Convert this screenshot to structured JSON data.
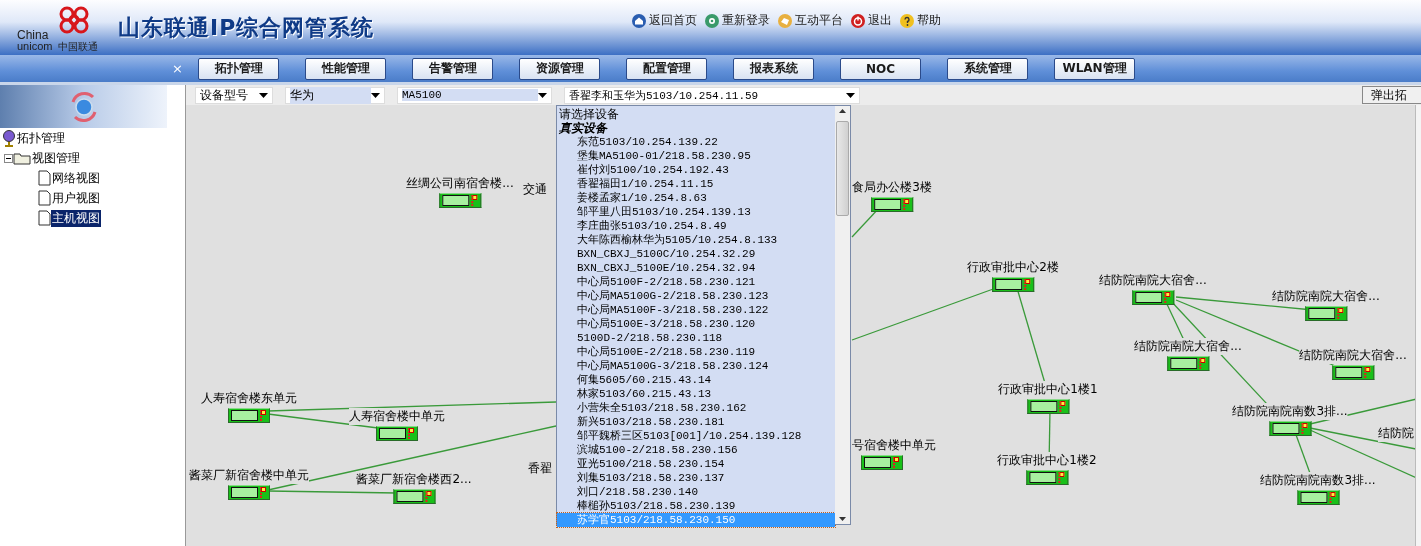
{
  "header": {
    "logo": {
      "line1": "China",
      "line2": "unicom",
      "line3": "中国联通"
    },
    "title": "山东联通IP综合网管系统",
    "links": [
      {
        "label": "返回首页"
      },
      {
        "label": "重新登录"
      },
      {
        "label": "互动平台"
      },
      {
        "label": "退出"
      },
      {
        "label": "帮助"
      }
    ]
  },
  "nav": {
    "close": "×",
    "tabs": [
      {
        "label": "拓扑管理",
        "selected": false
      },
      {
        "label": "性能管理",
        "selected": false
      },
      {
        "label": "告警管理",
        "selected": false
      },
      {
        "label": "资源管理",
        "selected": false
      },
      {
        "label": "配置管理",
        "selected": false
      },
      {
        "label": "报表系统",
        "selected": false
      },
      {
        "label": "NOC",
        "selected": false
      },
      {
        "label": "系统管理",
        "selected": false
      },
      {
        "label": "WLAN管理",
        "selected": false
      }
    ]
  },
  "sidebar": {
    "tree": [
      {
        "label": "拓扑管理",
        "selected": false,
        "children": [
          {
            "label": "视图管理",
            "selected": false,
            "expanded": true,
            "children": [
              {
                "label": "网络视图",
                "selected": false
              },
              {
                "label": "用户视图",
                "selected": false
              },
              {
                "label": "主机视图",
                "selected": true
              }
            ]
          }
        ]
      }
    ]
  },
  "filters": {
    "type": "设备型号",
    "vendor": "华为",
    "model": "MA5100",
    "device": "香翟李和玉华为5103/10.254.11.59",
    "popup_button": "弹出拓"
  },
  "device_list": [
    {
      "kind": "prompt",
      "label": "请选择设备",
      "selected": false
    },
    {
      "kind": "group",
      "label": "真实设备",
      "selected": false
    },
    {
      "kind": "item",
      "label": "东范5103/10.254.139.22",
      "selected": false
    },
    {
      "kind": "item",
      "label": "堡集MA5100-01/218.58.230.95",
      "selected": false
    },
    {
      "kind": "item",
      "label": "崔付刘5100/10.254.192.43",
      "selected": false
    },
    {
      "kind": "item",
      "label": "香翟福田1/10.254.11.15",
      "selected": false
    },
    {
      "kind": "item",
      "label": "姜楼孟家1/10.254.8.63",
      "selected": false
    },
    {
      "kind": "item",
      "label": "邹平里八田5103/10.254.139.13",
      "selected": false
    },
    {
      "kind": "item",
      "label": "李庄曲张5103/10.254.8.49",
      "selected": false
    },
    {
      "kind": "item",
      "label": "大年陈西榆林华为5105/10.254.8.133",
      "selected": false
    },
    {
      "kind": "item",
      "label": "BXN_CBXJ_5100C/10.254.32.29",
      "selected": false
    },
    {
      "kind": "item",
      "label": "BXN_CBXJ_5100E/10.254.32.94",
      "selected": false
    },
    {
      "kind": "item",
      "label": "中心局5100F-2/218.58.230.121",
      "selected": false
    },
    {
      "kind": "item",
      "label": "中心局MA5100G-2/218.58.230.123",
      "selected": false
    },
    {
      "kind": "item",
      "label": "中心局MA5100F-3/218.58.230.122",
      "selected": false
    },
    {
      "kind": "item",
      "label": "中心局5100E-3/218.58.230.120",
      "selected": false
    },
    {
      "kind": "item",
      "label": "5100D-2/218.58.230.118",
      "selected": false
    },
    {
      "kind": "item",
      "label": "中心局5100E-2/218.58.230.119",
      "selected": false
    },
    {
      "kind": "item",
      "label": "中心局MA5100G-3/218.58.230.124",
      "selected": false
    },
    {
      "kind": "item",
      "label": "何集5605/60.215.43.14",
      "selected": false
    },
    {
      "kind": "item",
      "label": "林家5103/60.215.43.13",
      "selected": false
    },
    {
      "kind": "item",
      "label": "小营朱全5103/218.58.230.162",
      "selected": false
    },
    {
      "kind": "item",
      "label": "新兴5103/218.58.230.181",
      "selected": false
    },
    {
      "kind": "item",
      "label": "邹平魏桥三区5103[001]/10.254.139.128",
      "selected": false
    },
    {
      "kind": "item",
      "label": "滨城5100-2/218.58.230.156",
      "selected": false
    },
    {
      "kind": "item",
      "label": "亚光5100/218.58.230.154",
      "selected": false
    },
    {
      "kind": "item",
      "label": "刘集5103/218.58.230.137",
      "selected": false
    },
    {
      "kind": "item",
      "label": "刘口/218.58.230.140",
      "selected": false
    },
    {
      "kind": "item",
      "label": "棒槌孙5103/218.58.230.139",
      "selected": false
    },
    {
      "kind": "item",
      "label": "苏学官5103/218.58.230.150",
      "selected": true
    }
  ],
  "topology": {
    "nodes": [
      {
        "label": "丝绸公司南宿舍楼..."
      },
      {
        "label": "交通"
      },
      {
        "label": "食局办公楼3楼"
      },
      {
        "label": "行政审批中心2楼"
      },
      {
        "label": "结防院南院大宿舍..."
      },
      {
        "label": "结防院南院大宿舍..."
      },
      {
        "label": "结防院南院大宿舍..."
      },
      {
        "label": "结防院南院大宿舍..."
      },
      {
        "label": "行政审批中心1楼1"
      },
      {
        "label": "结防院南院南数3排..."
      },
      {
        "label": "结防院"
      },
      {
        "label": "人寿宿舍楼东单元"
      },
      {
        "label": "人寿宿舍楼中单元"
      },
      {
        "label": "号宿舍楼中单元"
      },
      {
        "label": "行政审批中心1楼2"
      },
      {
        "label": "酱菜厂新宿舍楼中单元"
      },
      {
        "label": "香翟"
      },
      {
        "label": "酱菜厂新宿舍楼西2..."
      },
      {
        "label": "结防院南院南数3排..."
      }
    ]
  }
}
